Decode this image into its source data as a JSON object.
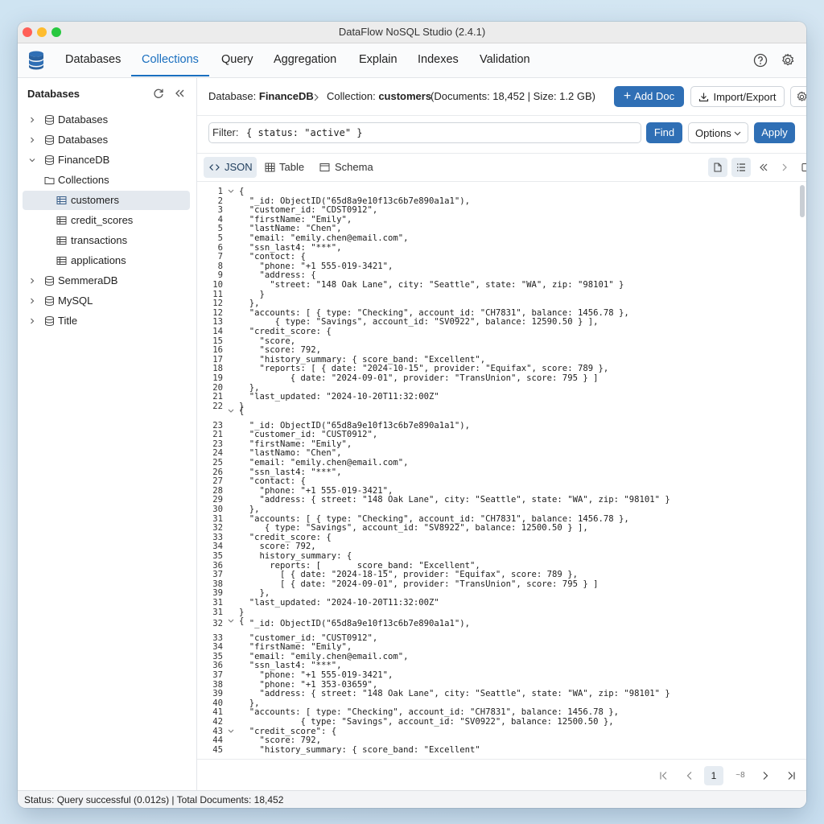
{
  "app": {
    "title": "DataFlow NoSQL Studio (2.4.1)"
  },
  "nav": {
    "items": [
      {
        "label": "Databases"
      },
      {
        "label": "Collections"
      },
      {
        "label": "Query"
      },
      {
        "label": "Aggregation"
      },
      {
        "label": "Explain"
      },
      {
        "label": "Indexes"
      },
      {
        "label": "Validation"
      }
    ],
    "active": "Collections",
    "help_icon": "help-circle-icon",
    "settings_icon": "gear-icon"
  },
  "sidebar": {
    "header": "Databases",
    "tree": [
      {
        "label": "Databases",
        "icon": "database-icon",
        "expanded": false
      },
      {
        "label": "Databases",
        "icon": "database-icon",
        "expanded": false
      },
      {
        "label": "FinanceDB",
        "icon": "database-icon",
        "expanded": true
      },
      {
        "label": "Collections",
        "icon": "folder-icon"
      },
      {
        "label": "customers",
        "icon": "table-icon",
        "selected": true
      },
      {
        "label": "credit_scores",
        "icon": "table-icon"
      },
      {
        "label": "transactions",
        "icon": "table-icon"
      },
      {
        "label": "applications",
        "icon": "table-icon"
      },
      {
        "label": "SemmeraDB",
        "icon": "database-icon",
        "expanded": false
      },
      {
        "label": "MySQL",
        "icon": "database-icon",
        "expanded": false
      },
      {
        "label": "Title",
        "icon": "database-icon",
        "expanded": false
      }
    ]
  },
  "breadcrumb": {
    "db_prefix": "Database: ",
    "db_name": "FinanceDB",
    "coll_prefix": "Collection: ",
    "coll_name": "customers",
    "meta": "(Documents: 18,452 | Size: 1.2 GB)"
  },
  "toolbar": {
    "add_doc": "Add Doc",
    "import_export": "Import/Export"
  },
  "filter": {
    "label": "Filter:",
    "value": "{ status: \"active\" }",
    "find": "Find",
    "options": "Options",
    "apply": "Apply"
  },
  "view_tabs": [
    {
      "label": "JSON",
      "active": true
    },
    {
      "label": "Table"
    },
    {
      "label": "Schema"
    }
  ],
  "code_lines": [
    {
      "n": "1",
      "fold": true,
      "t": "{"
    },
    {
      "n": "2",
      "t": "  \"_id: ObjectID(\"65d8a9e10f13c6b7e890a1a1\"),"
    },
    {
      "n": "3",
      "t": "  \"customer_id: \"CDST0912\","
    },
    {
      "n": "4",
      "t": "  \"firstName: \"Emily\","
    },
    {
      "n": "5",
      "t": "  \"lastName: \"Chen\","
    },
    {
      "n": "5",
      "t": "  \"email: \"emily.chen@email.com\","
    },
    {
      "n": "6",
      "t": "  \"ssn_last4: \"***\","
    },
    {
      "n": "7",
      "t": "  \"contoct: {"
    },
    {
      "n": "8",
      "t": "    \"phone: \"+1 555-019-3421\","
    },
    {
      "n": "9",
      "t": "    \"address: {"
    },
    {
      "n": "10",
      "t": "      \"street: \"148 Oak Lane\", city: \"Seattle\", state: \"WA\", zip: \"98101\" }"
    },
    {
      "n": "11",
      "t": "    }"
    },
    {
      "n": "12",
      "t": "  },"
    },
    {
      "n": "12",
      "t": "  \"accounts: [ { type: \"Checking\", account_id: \"CH7831\", balance: 1456.78 },"
    },
    {
      "n": "13",
      "t": "       { type: \"Savings\", account_id: \"SV0922\", balance: 12590.50 } ],"
    },
    {
      "n": "14",
      "t": "  \"credit_score: {"
    },
    {
      "n": "15",
      "t": "    \"score,"
    },
    {
      "n": "16",
      "t": "    \"score: 792,"
    },
    {
      "n": "17",
      "t": "    \"history_summary: { score_band: \"Excellent\","
    },
    {
      "n": "18",
      "t": "    \"reports: [ { date: \"2024-10-15\", provider: \"Equifax\", score: 789 },"
    },
    {
      "n": "19",
      "t": "          { date: \"2024-09-01\", provider: \"TransUnion\", score: 795 } ]"
    },
    {
      "n": "20",
      "t": "  },"
    },
    {
      "n": "21",
      "t": "  \"last_updated: \"2024-10-20T11:32:00Z\""
    },
    {
      "n": "22",
      "t": "}"
    },
    {
      "n": "",
      "fold": true,
      "t": "{"
    },
    {
      "n": "23",
      "t": "  \"_id: ObjectID(\"65d8a9e10f13c6b7e890a1a1\"),"
    },
    {
      "n": "21",
      "t": "  \"customer_id: \"CUST0912\","
    },
    {
      "n": "23",
      "t": "  \"firstName: \"Emily\","
    },
    {
      "n": "24",
      "t": "  \"lastNamo: \"Chen\","
    },
    {
      "n": "25",
      "t": "  \"email: \"emily.chen@email.com\","
    },
    {
      "n": "26",
      "t": "  \"ssn_last4: \"***\","
    },
    {
      "n": "27",
      "t": "  \"contact: {"
    },
    {
      "n": "28",
      "t": "    \"phone: \"+1 555-019-3421\","
    },
    {
      "n": "29",
      "t": "    \"address: { street: \"148 Oak Lane\", city: \"Seattle\", state: \"WA\", zip: \"98101\" }"
    },
    {
      "n": "30",
      "t": "  },"
    },
    {
      "n": "31",
      "t": "  \"accounts: [ { type: \"Checking\", account_id: \"CH7831\", balance: 1456.78 },"
    },
    {
      "n": "32",
      "t": "     { type: \"Savings\", account_id: \"SV8922\", balance: 12500.50 } ],"
    },
    {
      "n": "33",
      "t": "  \"credit_score: {"
    },
    {
      "n": "34",
      "t": "    score: 792,"
    },
    {
      "n": "35",
      "t": "    history_summary: {"
    },
    {
      "n": "36",
      "t": "      reports: [       score_band: \"Excellent\","
    },
    {
      "n": "37",
      "t": "        [ { date: \"2024-18-15\", provider: \"Equifax\", score: 789 },"
    },
    {
      "n": "38",
      "t": "        [ { date: \"2024-09-01\", provider: \"TransUnion\", score: 795 } ]"
    },
    {
      "n": "39",
      "t": "    },"
    },
    {
      "n": "31",
      "t": "  \"last_updated: \"2024-10-20T11:32:00Z\""
    },
    {
      "n": "31",
      "t": "}"
    },
    {
      "n": "",
      "fold": true,
      "t": "{"
    },
    {
      "n": "32",
      "t": "  \"_id: ObjectID(\"65d8a9e10f13c6b7e890a1a1\"),"
    },
    {
      "n": "33",
      "t": "  \"customer_id: \"CUST0912\","
    },
    {
      "n": "34",
      "t": "  \"firstName: \"Emily\","
    },
    {
      "n": "35",
      "t": "  \"email: \"emily.chen@email.com\","
    },
    {
      "n": "36",
      "t": "  \"ssn_last4: \"***\","
    },
    {
      "n": "37",
      "t": "    \"phone: \"+1 555-019-3421\","
    },
    {
      "n": "38",
      "t": "    \"phone: \"+1 353-03659\","
    },
    {
      "n": "39",
      "t": "    \"address: { street: \"148 Oak Lane\", city: \"Seattle\", state: \"WA\", zip: \"98101\" }"
    },
    {
      "n": "40",
      "t": "  },"
    },
    {
      "n": "41",
      "t": "  \"accounts: [ type: \"Checking\", account_id: \"CH7831\", balance: 1456.78 },"
    },
    {
      "n": "42",
      "t": "            { type: \"Savings\", account_id: \"SV0922\", balance: 12500.50 },"
    },
    {
      "n": "43",
      "fold": true,
      "t": "  \"credit_score\": {"
    },
    {
      "n": "44",
      "t": "    \"score: 792,"
    },
    {
      "n": "45",
      "t": "    \"history_summary: { score_band: \"Excellent\""
    }
  ],
  "pagination": {
    "current": "1",
    "next_page": "~8"
  },
  "status": {
    "text": "Status: Query successful (0.012s) | Total Documents: 18,452"
  },
  "colors": {
    "accent": "#2f6fb5",
    "active_tab": "#1a6fbf"
  }
}
